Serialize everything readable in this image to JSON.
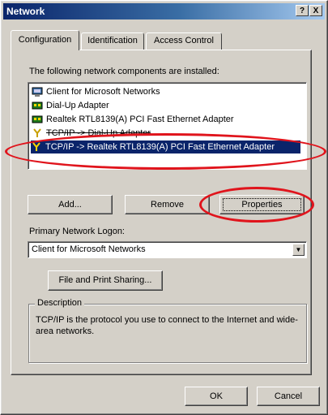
{
  "window": {
    "title": "Network",
    "help_button": "?",
    "close_button": "X"
  },
  "tabs": [
    {
      "label": "Configuration",
      "active": true
    },
    {
      "label": "Identification",
      "active": false
    },
    {
      "label": "Access Control",
      "active": false
    }
  ],
  "components": {
    "heading": "The following network components are installed:",
    "items": [
      {
        "label": "Client for Microsoft Networks",
        "icon": "client-icon"
      },
      {
        "label": "Dial-Up Adapter",
        "icon": "adapter-icon"
      },
      {
        "label": "Realtek RTL8139(A) PCI Fast Ethernet Adapter",
        "icon": "adapter-icon"
      },
      {
        "label": "TCP/IP -> Dial-Up Adapter",
        "icon": "protocol-icon"
      },
      {
        "label": "TCP/IP -> Realtek RTL8139(A) PCI Fast Ethernet Adapter",
        "icon": "protocol-icon",
        "selected": true
      }
    ]
  },
  "buttons": {
    "add": "Add...",
    "remove": "Remove",
    "properties": "Properties",
    "file_print": "File and Print Sharing...",
    "ok": "OK",
    "cancel": "Cancel"
  },
  "logon": {
    "label": "Primary Network Logon:",
    "value": "Client for Microsoft Networks"
  },
  "description": {
    "legend": "Description",
    "text": "TCP/IP is the protocol you use to connect to the Internet and wide-area networks."
  },
  "colors": {
    "selection": "#0a246a",
    "annotation": "#e0141c"
  }
}
